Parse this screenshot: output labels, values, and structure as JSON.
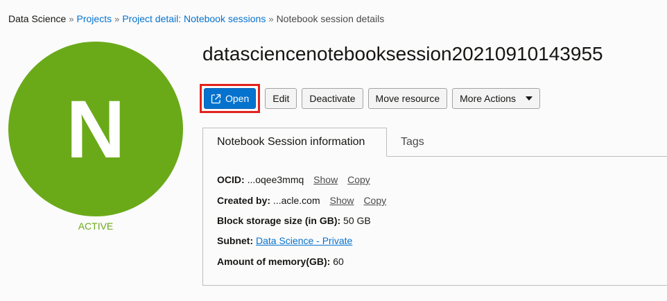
{
  "breadcrumb": {
    "root": "Data Science",
    "separator": "»",
    "projects": "Projects",
    "project_detail": "Project detail: Notebook sessions",
    "current": "Notebook session details"
  },
  "avatar": {
    "letter": "N",
    "state": "ACTIVE",
    "color": "#6aaa19"
  },
  "title": "datasciencenotebooksession20210910143955",
  "actions": {
    "open": "Open",
    "open_icon": "external-link-icon",
    "edit": "Edit",
    "deactivate": "Deactivate",
    "move_resource": "Move resource",
    "more_actions": "More Actions"
  },
  "tabs": {
    "info": "Notebook Session information",
    "tags": "Tags"
  },
  "info": {
    "ocid_label": "OCID:",
    "ocid_value": "...oqee3mmq",
    "created_by_label": "Created by:",
    "created_by_value": "...acle.com",
    "show": "Show",
    "copy": "Copy",
    "block_storage_label": "Block storage size (in GB):",
    "block_storage_value": "50 GB",
    "subnet_label": "Subnet:",
    "subnet_value": "Data Science - Private",
    "memory_label": "Amount of memory(GB):",
    "memory_value": "60"
  },
  "colors": {
    "accent": "#0572ce",
    "active": "#6aaa19",
    "highlight": "#e2211c"
  }
}
